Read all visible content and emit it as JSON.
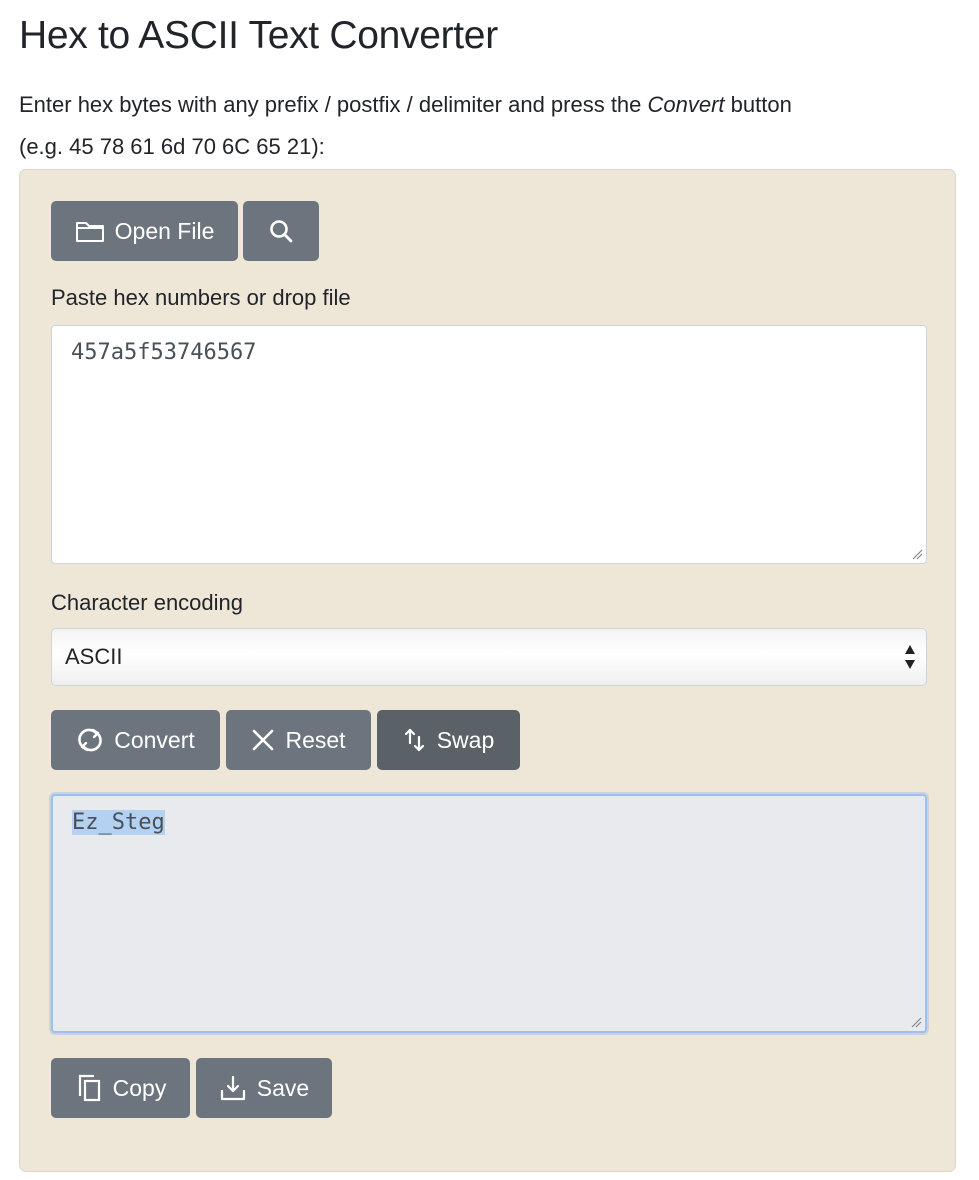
{
  "page": {
    "title": "Hex to ASCII Text Converter",
    "intro_before": "Enter hex bytes with any prefix / postfix / delimiter and press the ",
    "intro_emph": "Convert",
    "intro_after": " button",
    "intro_example": "(e.g. 45 78 61 6d 70 6C 65 21):"
  },
  "toolbar": {
    "open_file_label": "Open File",
    "open_file_icon": "folder-icon",
    "search_icon": "search-icon"
  },
  "input": {
    "label": "Paste hex numbers or drop file",
    "value": "457a5f53746567"
  },
  "encoding": {
    "label": "Character encoding",
    "selected": "ASCII"
  },
  "actions": {
    "convert_label": "Convert",
    "convert_icon": "refresh-icon",
    "reset_label": "Reset",
    "reset_icon": "close-icon",
    "swap_label": "Swap",
    "swap_icon": "swap-arrows-icon"
  },
  "output": {
    "value": "Ez_Steg"
  },
  "output_actions": {
    "copy_label": "Copy",
    "copy_icon": "copy-icon",
    "save_label": "Save",
    "save_icon": "download-icon"
  },
  "colors": {
    "panel_bg": "#eee7d8",
    "button_bg": "#6c757d",
    "output_bg": "#e9eaee",
    "focus_border": "#9cc0ec",
    "selection": "#b5d1f2"
  }
}
